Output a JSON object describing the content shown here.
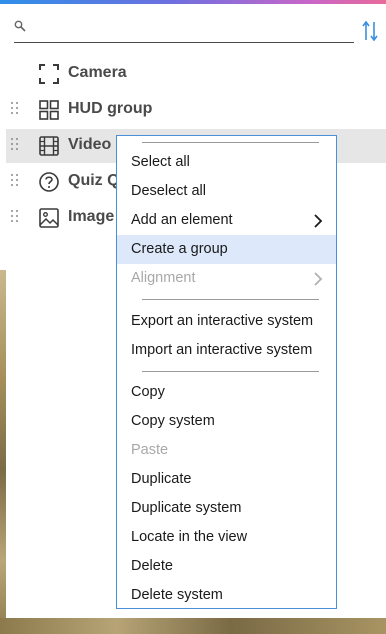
{
  "search": {
    "placeholder": "",
    "value": ""
  },
  "tree": [
    {
      "label": "Camera",
      "icon": "camera-frame-icon",
      "draggable": false,
      "selected": false
    },
    {
      "label": "HUD group",
      "icon": "grid-group-icon",
      "draggable": true,
      "selected": false
    },
    {
      "label": "Video",
      "icon": "film-icon",
      "draggable": true,
      "selected": true
    },
    {
      "label": "Quiz Q",
      "icon": "question-circle-icon",
      "draggable": true,
      "selected": false
    },
    {
      "label": "Image",
      "icon": "image-icon",
      "draggable": true,
      "selected": false
    }
  ],
  "context_menu": {
    "items": [
      {
        "label": "Select all",
        "enabled": true
      },
      {
        "label": "Deselect all",
        "enabled": true
      },
      {
        "label": "Add an element",
        "enabled": true,
        "submenu": true
      },
      {
        "label": "Create a group",
        "enabled": true,
        "highlighted": true
      },
      {
        "label": "Alignment",
        "enabled": false,
        "submenu": true
      },
      {
        "label": "Export an interactive system",
        "enabled": true
      },
      {
        "label": "Import an interactive system",
        "enabled": true
      },
      {
        "label": "Copy",
        "enabled": true
      },
      {
        "label": "Copy system",
        "enabled": true
      },
      {
        "label": "Paste",
        "enabled": false
      },
      {
        "label": "Duplicate",
        "enabled": true
      },
      {
        "label": "Duplicate system",
        "enabled": true
      },
      {
        "label": "Locate in the view",
        "enabled": true
      },
      {
        "label": "Delete",
        "enabled": true
      },
      {
        "label": "Delete system",
        "enabled": true
      }
    ]
  },
  "colors": {
    "accent": "#4a90d9",
    "highlight": "#dde9fa",
    "selected_row": "#e6e6e6",
    "disabled_text": "#a8a8a8"
  }
}
